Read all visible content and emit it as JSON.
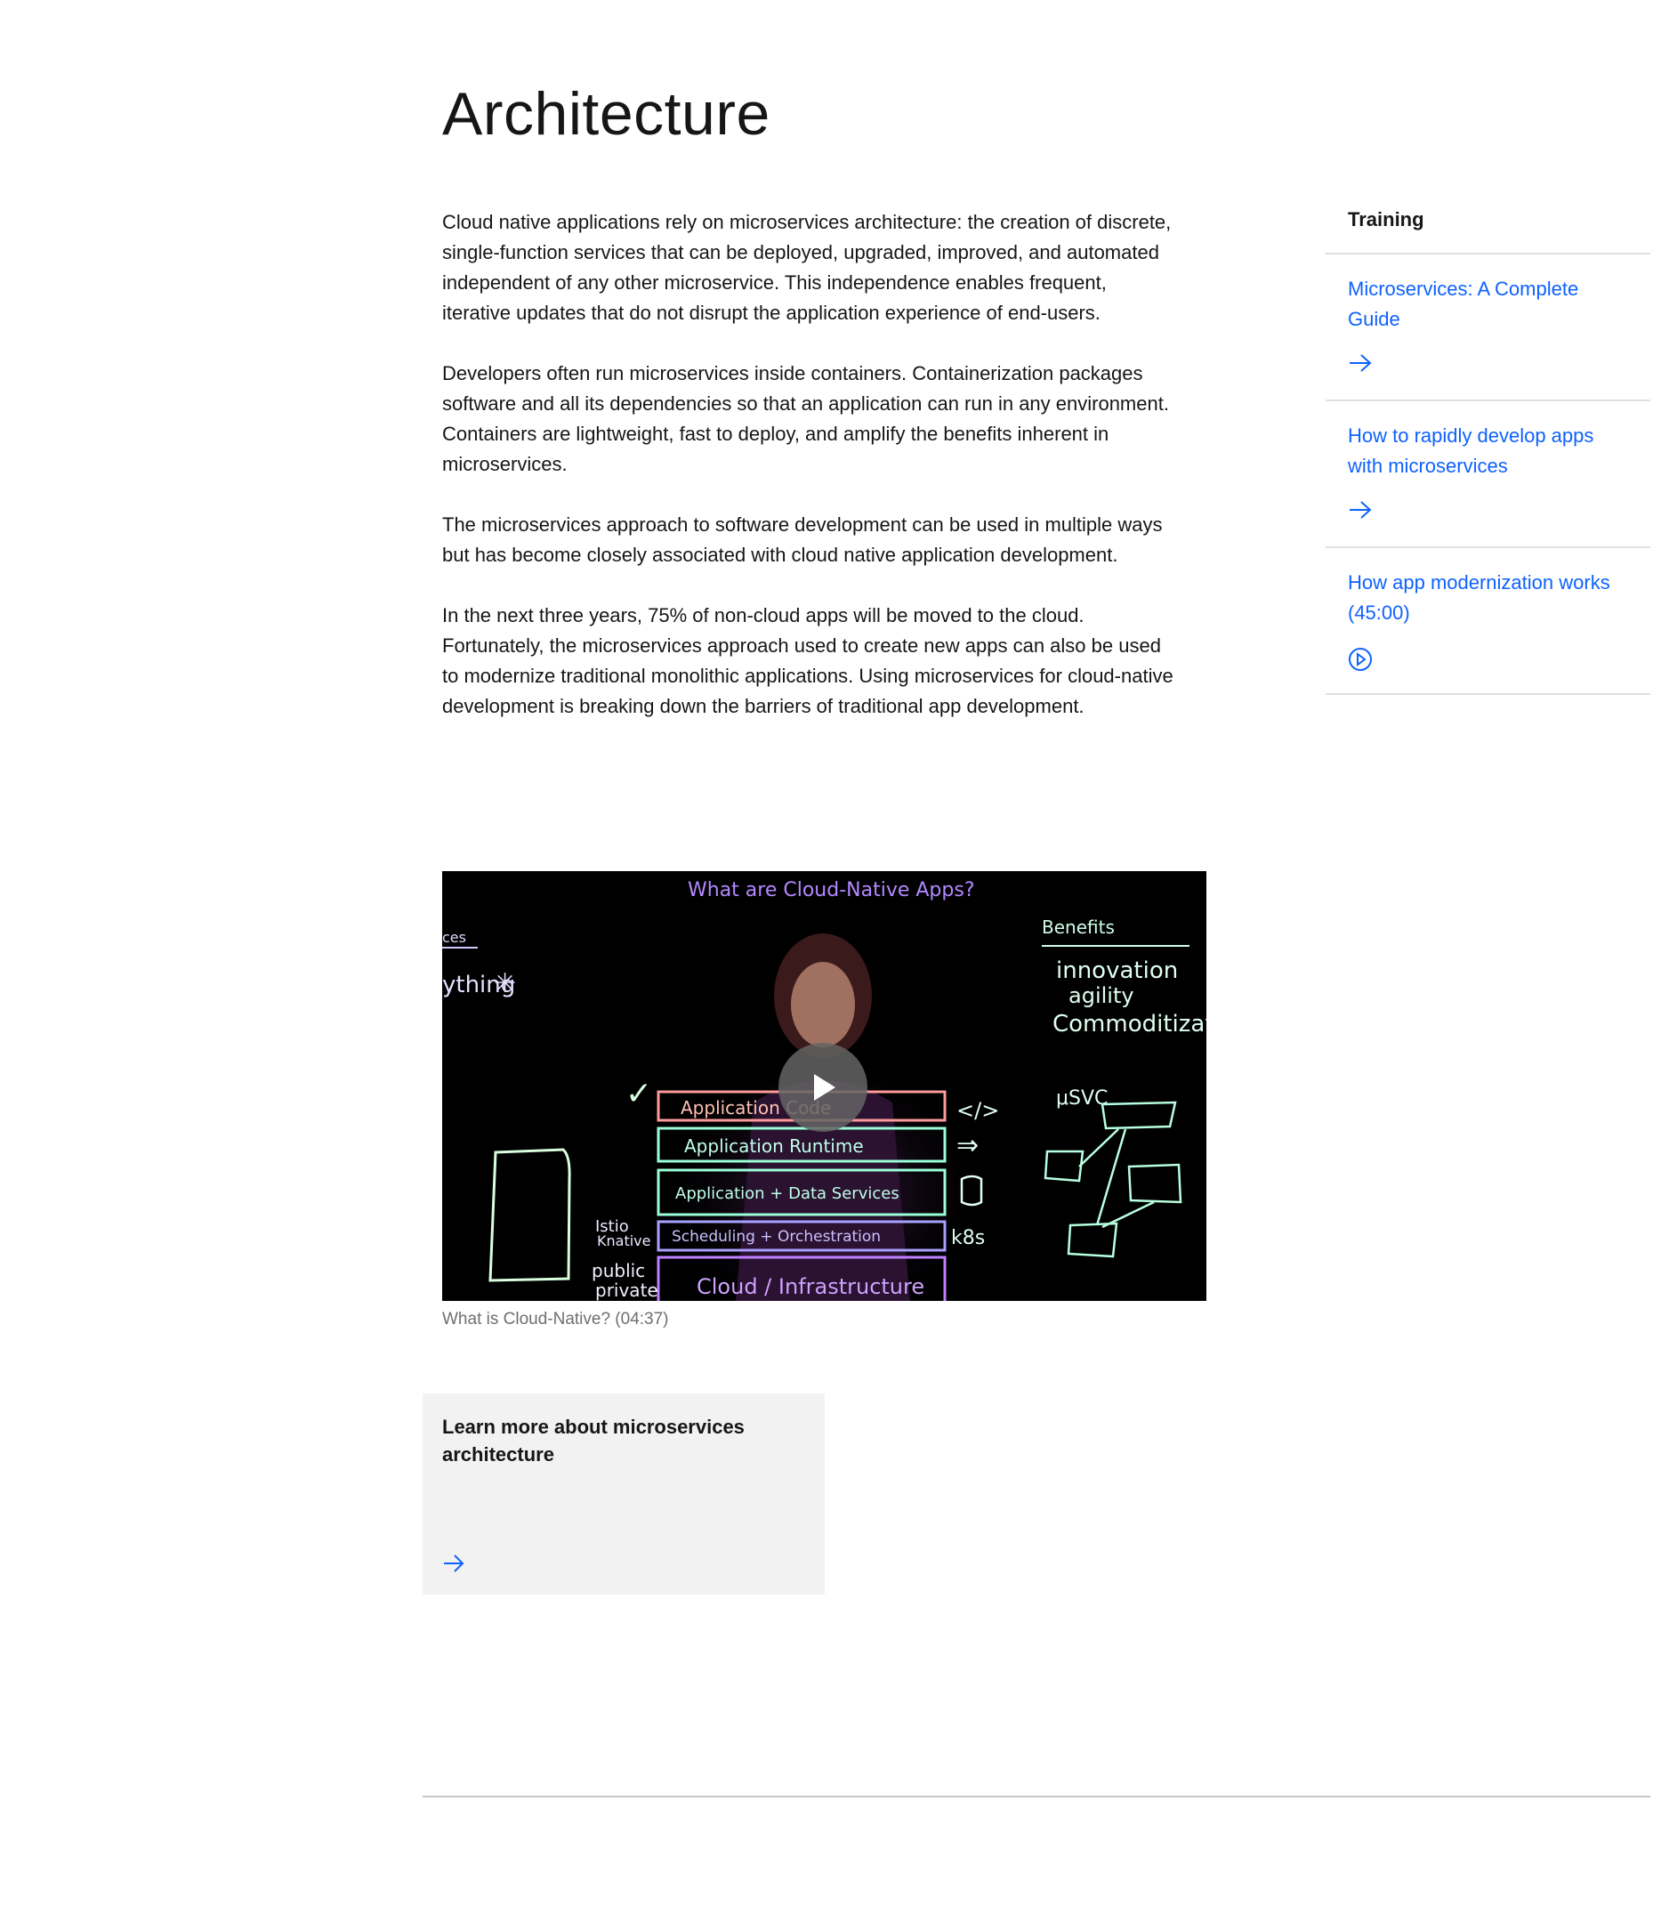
{
  "page": {
    "title": "Architecture",
    "paragraphs": [
      "Cloud native applications rely on microservices architecture: the creation of discrete, single-function services that can be deployed, upgraded, improved, and automated independent of any other microservice. This independence enables frequent, iterative updates that do not disrupt the application experience of end-users.",
      "Developers often run microservices inside containers. Containerization packages software and all its dependencies so that an application can run in any environment. Containers are lightweight, fast to deploy, and amplify the benefits inherent in microservices.",
      "The microservices approach to software development can be used in multiple ways but has become closely associated with cloud native application development.",
      "In the next three years, 75% of non-cloud apps will be moved to the cloud. Fortunately, the microservices approach used to create new apps can also be used to modernize traditional monolithic applications. Using microservices for cloud-native development is breaking down the barriers of traditional app development."
    ]
  },
  "video": {
    "caption": "What is Cloud-Native? (04:37)",
    "board": {
      "heading": "What are Cloud-Native Apps?",
      "left_top": "ces",
      "left_mid": "ything",
      "benefits": "Benefits",
      "benefit_1": "innovation",
      "benefit_2": "agility",
      "benefit_3": "Commoditizati",
      "check": "✓",
      "layer_1": "Application Code",
      "layer_2": "Application Runtime",
      "layer_3": "Application + Data Services",
      "layer_4": "Scheduling + Orchestration",
      "layer_5": "Cloud / Infrastructure",
      "code_symbol": "</>",
      "arrows_symbol": "⇒",
      "k8s": "k8s",
      "usvc": "μSVC",
      "istio": "Istio",
      "knative": "Knative",
      "public": "public",
      "private": "private"
    },
    "icon": "play-icon"
  },
  "card": {
    "title": "Learn more about microservices architecture",
    "icon": "arrow-right-icon"
  },
  "sidebar": {
    "heading": "Training",
    "items": [
      {
        "label": "Microservices: A Complete Guide",
        "icon": "arrow-right-icon"
      },
      {
        "label": "How to rapidly develop apps with microservices",
        "icon": "arrow-right-icon"
      },
      {
        "label": "How app modernization works (45:00)",
        "icon": "play-circle-icon"
      }
    ]
  },
  "colors": {
    "link": "#0f62fe",
    "text": "#161616",
    "caption": "#6f6f6f",
    "card_bg": "#f2f2f2",
    "divider": "#e0e0e0"
  }
}
